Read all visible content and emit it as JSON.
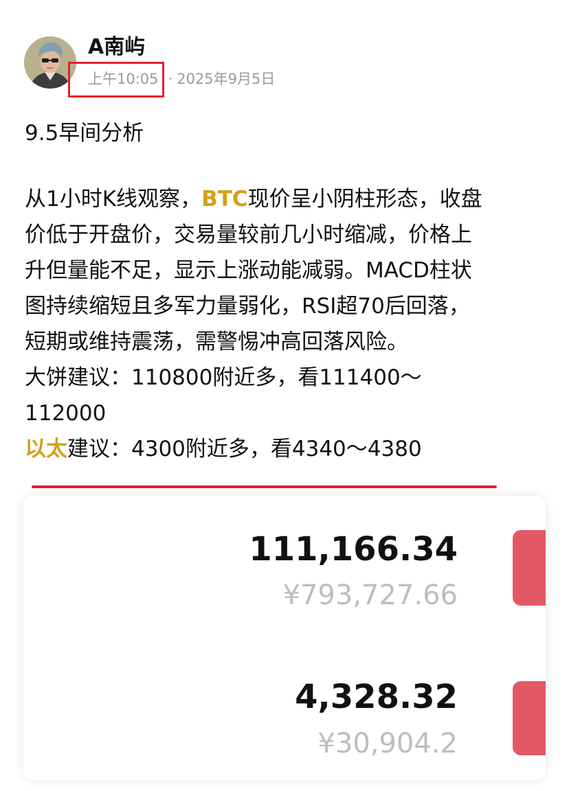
{
  "author": {
    "name": "A南屿",
    "avatar_icon": "cartoon-avatar-icon"
  },
  "meta": {
    "time": "上午10:05",
    "separator": "·",
    "date": "2025年9月5日"
  },
  "post": {
    "title": "9.5早间分析",
    "lines": {
      "l1_pre": "从1小时K线观察，",
      "l1_btc": "BTC",
      "l1_post": "现价呈小阴柱形态，收盘",
      "l2": "价低于开盘价，交易量较前几小时缩减，价格上",
      "l3": "升但量能不足，显示上涨动能减弱。MACD柱状",
      "l4": "图持续缩短且多军力量弱化，RSI超70后回落，",
      "l5": "短期或维持震荡，需警惕冲高回落风险。",
      "l6": "大饼建议：110800附近多，看111400～",
      "l7": "112000",
      "l8_eth": "以太",
      "l8_post": "建议：4300附近多，看4340～4380"
    }
  },
  "prices": [
    {
      "price": "111,166.34",
      "cny": "¥793,727.66"
    },
    {
      "price": "4,328.32",
      "cny": "¥30,904.2"
    }
  ],
  "colors": {
    "accent_gold": "#d4a017",
    "annotation_red": "#e2202c",
    "button_red": "#e45866"
  }
}
